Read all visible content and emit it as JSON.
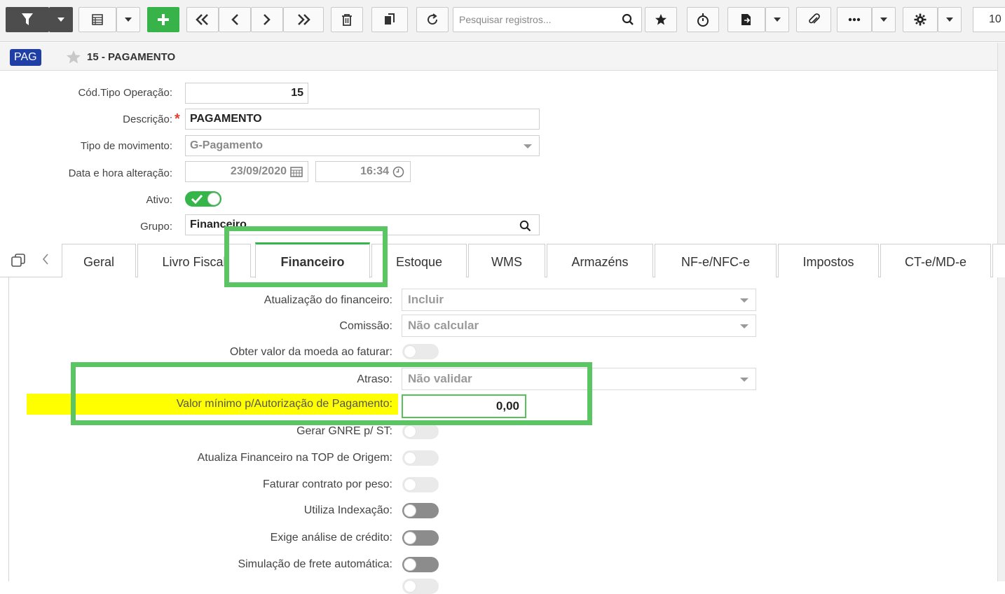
{
  "toolbar": {
    "search_placeholder": "Pesquisar registros...",
    "page_count": "10",
    "icons": [
      "filter-icon",
      "chevron-down-icon",
      "grid-icon",
      "chevron-down-icon",
      "plus-icon",
      "first-icon",
      "prev-icon",
      "next-icon",
      "last-icon",
      "trash-icon",
      "copy-icon",
      "refresh-icon",
      "search-icon",
      "star-icon",
      "timer-icon",
      "export-icon",
      "chevron-down-icon",
      "paperclip-icon",
      "more-icon",
      "chevron-down-icon",
      "gear-icon",
      "chevron-down-icon"
    ]
  },
  "titlebar": {
    "badge": "PAG",
    "title": "15 - PAGAMENTO"
  },
  "header_form": {
    "cod_label": "Cód.Tipo Operação:",
    "cod_value": "15",
    "desc_label": "Descrição:",
    "desc_required": "*",
    "desc_value": "PAGAMENTO",
    "tipo_label": "Tipo de movimento:",
    "tipo_value": "G-Pagamento",
    "data_label": "Data e hora alteração:",
    "data_value": "23/09/2020",
    "hora_value": "16:34",
    "ativo_label": "Ativo:",
    "ativo_on": true,
    "grupo_label": "Grupo:",
    "grupo_value": "Financeiro"
  },
  "tabs": [
    {
      "label": "Geral"
    },
    {
      "label": "Livro Fiscal"
    },
    {
      "label": "Financeiro",
      "active": true
    },
    {
      "label": "Estoque"
    },
    {
      "label": "WMS"
    },
    {
      "label": "Armazéns"
    },
    {
      "label": "NF-e/NFC-e"
    },
    {
      "label": "Impostos"
    },
    {
      "label": "CT-e/MD-e"
    }
  ],
  "financeiro": {
    "atualizacao_label": "Atualização do financeiro:",
    "atualizacao_value": "Incluir",
    "comissao_label": "Comissão:",
    "comissao_value": "Não calcular",
    "obter_label": "Obter valor da moeda ao faturar:",
    "atraso_label": "Atraso:",
    "atraso_value": "Não validar",
    "valor_min_label": "Valor mínimo p/Autorização de Pagamento:",
    "valor_min_value": "0,00",
    "gnre_label": "Gerar GNRE p/ ST:",
    "atualiza_top_label": "Atualiza Financeiro na TOP de Origem:",
    "faturar_peso_label": "Faturar contrato por peso:",
    "indexacao_label": "Utiliza Indexação:",
    "credito_label": "Exige análise de crédito:",
    "frete_label": "Simulação de frete automática:"
  },
  "colors": {
    "accent_green": "#35b54a",
    "badge_blue": "#1f3fa6",
    "highlight_yellow": "#ffff00",
    "annotation_green": "#5cc563",
    "required_red": "#e0402f"
  }
}
